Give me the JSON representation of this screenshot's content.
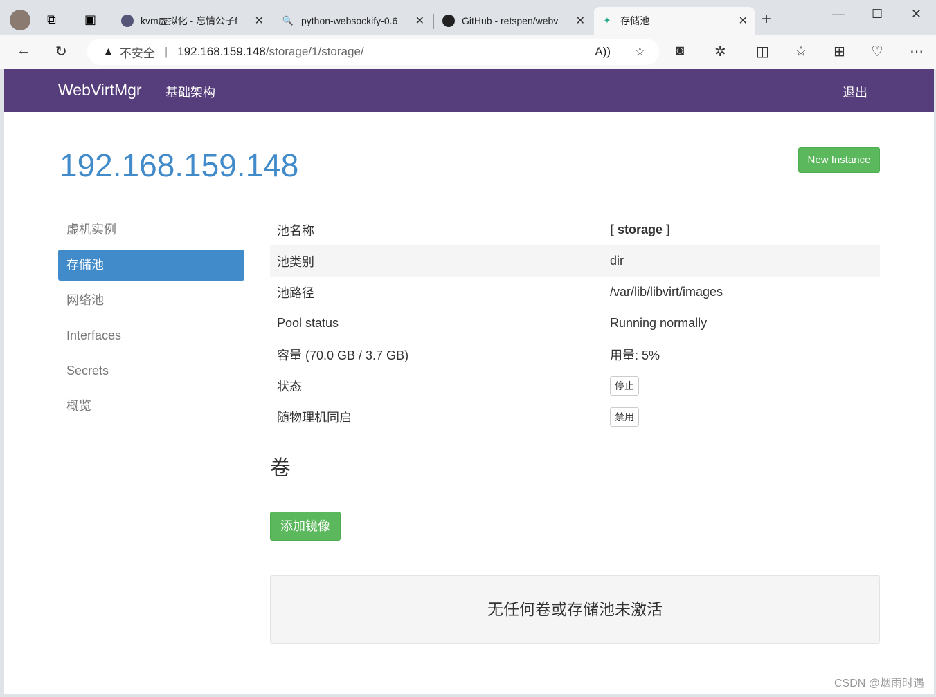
{
  "browser": {
    "tabs": [
      {
        "title": "kvm虚拟化 - 忘情公子f"
      },
      {
        "title": "python-websockify-0.6"
      },
      {
        "title": "GitHub - retspen/webv"
      },
      {
        "title": "存储池"
      }
    ],
    "security": "不安全",
    "url_host": "192.168.159.148",
    "url_path": "/storage/1/storage/"
  },
  "nav": {
    "brand": "WebVirtMgr",
    "infra": "基础架构",
    "logout": "退出"
  },
  "header": {
    "title": "192.168.159.148",
    "new_instance": "New Instance"
  },
  "sidebar": {
    "items": [
      {
        "label": "虚机实例"
      },
      {
        "label": "存储池",
        "active": true
      },
      {
        "label": "网络池"
      },
      {
        "label": "Interfaces"
      },
      {
        "label": "Secrets"
      },
      {
        "label": "概览"
      }
    ]
  },
  "pool": {
    "rows": [
      {
        "label": "池名称",
        "value": "[ storage ]"
      },
      {
        "label": "池类别",
        "value": "dir"
      },
      {
        "label": "池路径",
        "value": "/var/lib/libvirt/images"
      },
      {
        "label": "Pool status",
        "value": "Running normally"
      },
      {
        "label": "容量 (70.0 GB / 3.7 GB)",
        "value": "用量: 5%"
      },
      {
        "label": "状态",
        "button": "停止"
      },
      {
        "label": "随物理机同启",
        "button": "禁用"
      }
    ]
  },
  "volumes": {
    "heading": "卷",
    "add_button": "添加镜像",
    "empty": "无任何卷或存储池未激活"
  },
  "watermark": "CSDN @烟雨时遇"
}
